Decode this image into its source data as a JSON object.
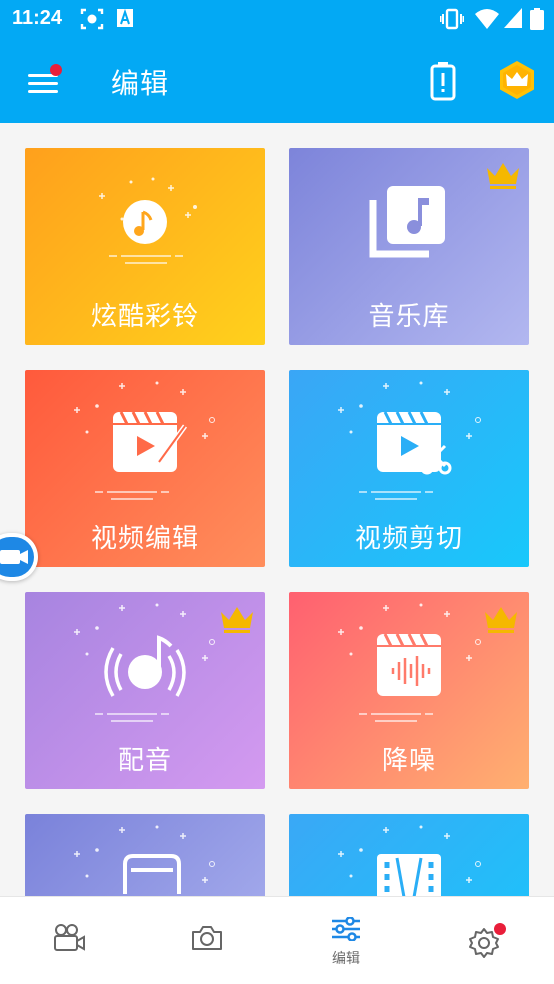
{
  "status_bar": {
    "time": "11:24"
  },
  "app_bar": {
    "title": "编辑"
  },
  "tiles": [
    {
      "label": "炫酷彩铃",
      "icon": "music-disc-icon",
      "vip": false,
      "colors": [
        "#ffa01c",
        "#ffd11c"
      ]
    },
    {
      "label": "音乐库",
      "icon": "music-library-icon",
      "vip": true,
      "colors": [
        "#7d84da",
        "#b2b7f0"
      ]
    },
    {
      "label": "视频编辑",
      "icon": "video-edit-icon",
      "vip": false,
      "colors": [
        "#ff5a3c",
        "#ff8e5c"
      ]
    },
    {
      "label": "视频剪切",
      "icon": "video-cut-icon",
      "vip": false,
      "colors": [
        "#3aa6f6",
        "#18c8fb"
      ]
    },
    {
      "label": "配音",
      "icon": "dubbing-icon",
      "vip": true,
      "colors": [
        "#a784e0",
        "#d49af0"
      ]
    },
    {
      "label": "降噪",
      "icon": "noise-reduction-icon",
      "vip": true,
      "colors": [
        "#ff6070",
        "#ffb070"
      ]
    },
    {
      "label": "",
      "icon": "music-note-icon",
      "vip": false,
      "colors": [
        "#7a82da",
        "#aeb4f0"
      ]
    },
    {
      "label": "",
      "icon": "film-strip-icon",
      "vip": false,
      "colors": [
        "#3aa8f6",
        "#18c8fb"
      ]
    }
  ],
  "bottom_nav": {
    "items": [
      {
        "name": "record-video",
        "label": "",
        "icon": "video-camera-icon"
      },
      {
        "name": "camera",
        "label": "",
        "icon": "camera-icon"
      },
      {
        "name": "edit",
        "label": "编辑",
        "icon": "sliders-icon",
        "active": true
      },
      {
        "name": "settings",
        "label": "",
        "icon": "gear-icon",
        "badge": true
      }
    ]
  },
  "colors": {
    "primary": "#03a9f4",
    "badge": "#e91e3a",
    "crown": "#f5b800"
  }
}
